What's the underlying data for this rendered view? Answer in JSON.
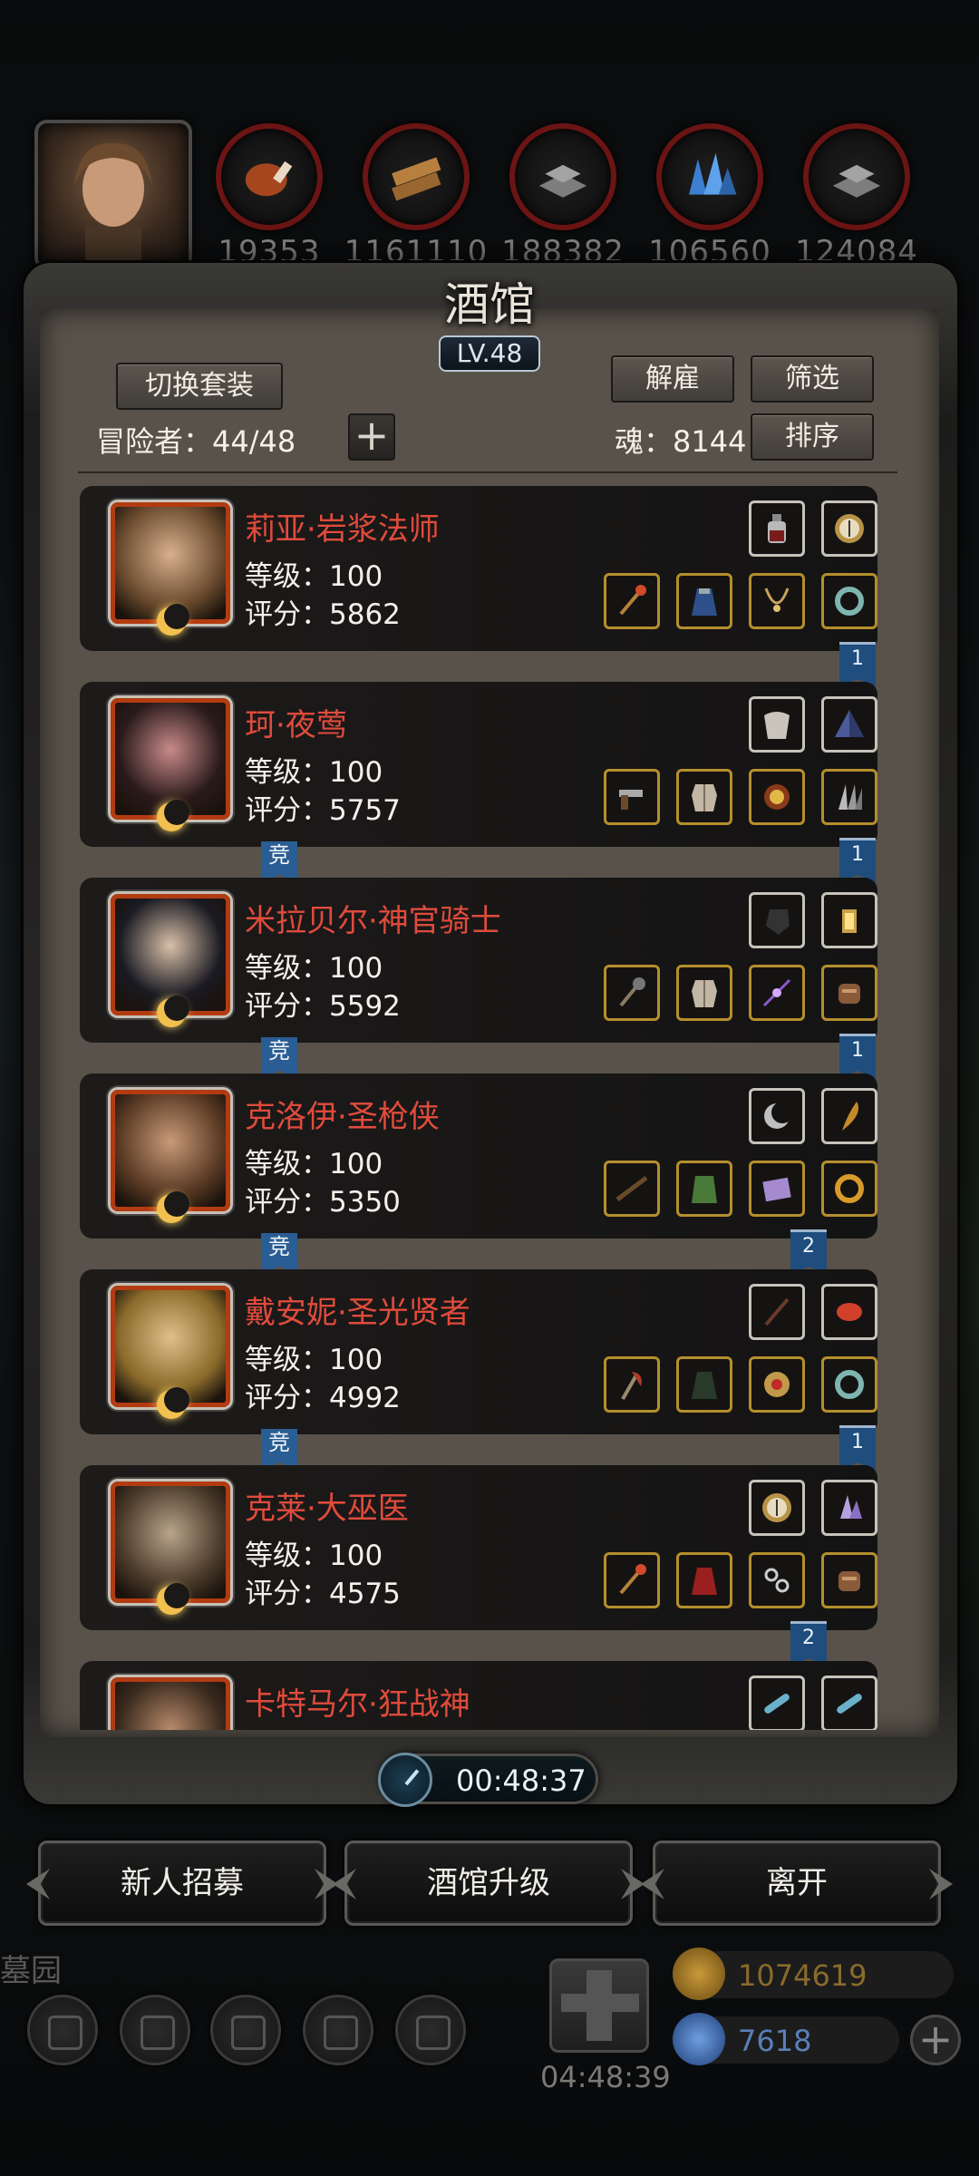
{
  "resources": [
    {
      "icon": "meat-icon",
      "value": "19353"
    },
    {
      "icon": "wood-planks-icon",
      "value": "1161110"
    },
    {
      "icon": "iron-bars-icon",
      "value": "188382"
    },
    {
      "icon": "blue-crystal-icon",
      "value": "106560"
    },
    {
      "icon": "metal-ingot-icon",
      "value": "124084"
    }
  ],
  "panel": {
    "title": "酒馆",
    "level": "LV.48",
    "switch_outfit": "切换套装",
    "dismiss": "解雇",
    "filter": "筛选",
    "sort": "排序",
    "adventurers_label": "冒险者：44/48",
    "soul_label": "魂：8144",
    "add_symbol": "+"
  },
  "heroes": [
    {
      "name": "莉亚·岩浆法师",
      "level": "等级：100",
      "score": "评分：5862",
      "rank": "1",
      "compete": "",
      "runner": false,
      "slots_top": [
        "bottle-icon",
        "compass-icon"
      ],
      "slots_bottom": [
        "staff-icon",
        "cloak-icon",
        "necklace-icon",
        "ring-icon"
      ]
    },
    {
      "name": "珂·夜莺",
      "level": "等级：100",
      "score": "评分：5757",
      "rank": "1",
      "compete": "竞",
      "runner": false,
      "slots_top": [
        "fur-cloak-icon",
        "pyramid-icon"
      ],
      "slots_bottom": [
        "pistol-icon",
        "vest-icon",
        "amulet-icon",
        "claw-icon"
      ]
    },
    {
      "name": "米拉贝尔·神官骑士",
      "level": "等级：100",
      "score": "评分：5592",
      "rank": "1",
      "compete": "竞",
      "runner": false,
      "slots_top": [
        "gauntlet-icon",
        "lantern-icon"
      ],
      "slots_bottom": [
        "mace-icon",
        "armor-icon",
        "spark-icon",
        "bracer-icon"
      ]
    },
    {
      "name": "克洛伊·圣枪侠",
      "level": "等级：100",
      "score": "评分：5350",
      "rank": "2",
      "compete": "竞",
      "runner": true,
      "slots_top": [
        "moon-icon",
        "quill-icon"
      ],
      "slots_bottom": [
        "rifle-icon",
        "chainmail-icon",
        "tome-icon",
        "gold-ring-icon"
      ]
    },
    {
      "name": "戴安妮·圣光贤者",
      "level": "等级：100",
      "score": "评分：4992",
      "rank": "1",
      "compete": "竞",
      "runner": false,
      "slots_top": [
        "wand-icon",
        "red-gem-icon"
      ],
      "slots_bottom": [
        "axe-icon",
        "robe-icon",
        "brooch-icon",
        "ring-icon"
      ]
    },
    {
      "name": "克莱·大巫医",
      "level": "等级：100",
      "score": "评分：4575",
      "rank": "2",
      "compete": "",
      "runner": true,
      "slots_top": [
        "compass-icon",
        "crystal-icon"
      ],
      "slots_bottom": [
        "staff-icon",
        "red-cloak-icon",
        "chain-icon",
        "bracelet-icon"
      ]
    },
    {
      "name": "卡特马尔·狂战神",
      "level": "",
      "score": "",
      "rank": "",
      "compete": "",
      "runner": false,
      "slots_top": [
        "blade-icon",
        "blade-icon"
      ],
      "slots_bottom": []
    }
  ],
  "timer": "00:48:37",
  "actions": {
    "recruit": "新人招募",
    "upgrade": "酒馆升级",
    "leave": "离开"
  },
  "footer": {
    "location": "墓园",
    "chest_timer": "04:48:39",
    "gold": "1074619",
    "gems": "7618",
    "add_symbol": "+"
  },
  "colors": {
    "name_red": "#e04b3c",
    "rank_blue": "#1e4d7e",
    "gold_text": "#8a6a2c",
    "gem_text": "#5a7fb8"
  }
}
